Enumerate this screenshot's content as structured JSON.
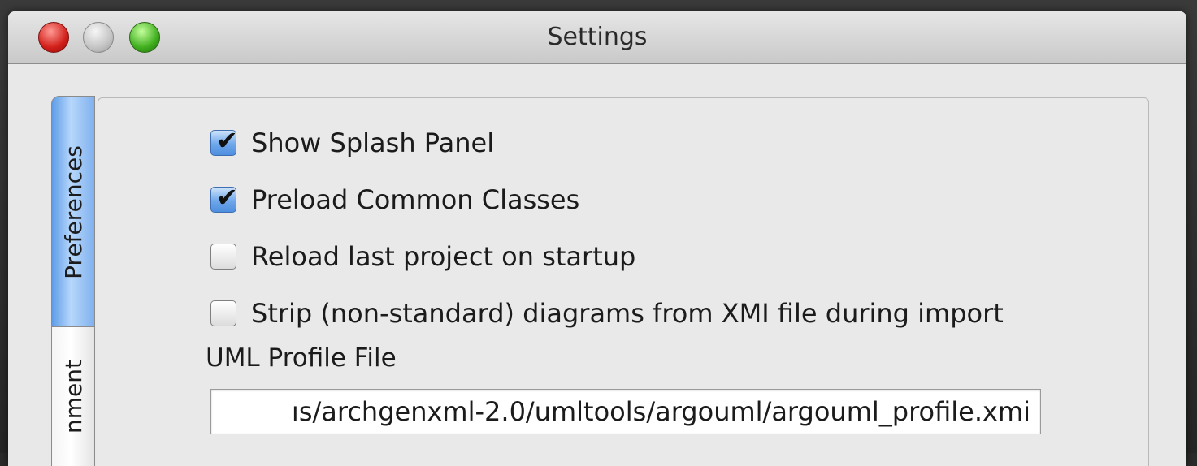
{
  "window": {
    "title": "Settings"
  },
  "tabs": [
    {
      "label": "Preferences",
      "active": true
    },
    {
      "label": "nment",
      "active": false
    }
  ],
  "preferences": {
    "options": [
      {
        "label": "Show Splash Panel",
        "checked": true
      },
      {
        "label": "Preload Common Classes",
        "checked": true
      },
      {
        "label": "Reload last project on startup",
        "checked": false
      },
      {
        "label": "Strip (non-standard) diagrams from XMI file during import",
        "checked": false
      }
    ],
    "profile_label": "UML Profile File",
    "profile_path": "ıs/archgenxml-2.0/umltools/argouml/argouml_profile.xmi"
  },
  "colors": {
    "selected_tab": "#9cc6f6",
    "close_button": "#d21f1a",
    "zoom_button": "#3fae1e",
    "checkbox_checked": "#6ea7ea"
  },
  "icons": {
    "check": "✔"
  }
}
